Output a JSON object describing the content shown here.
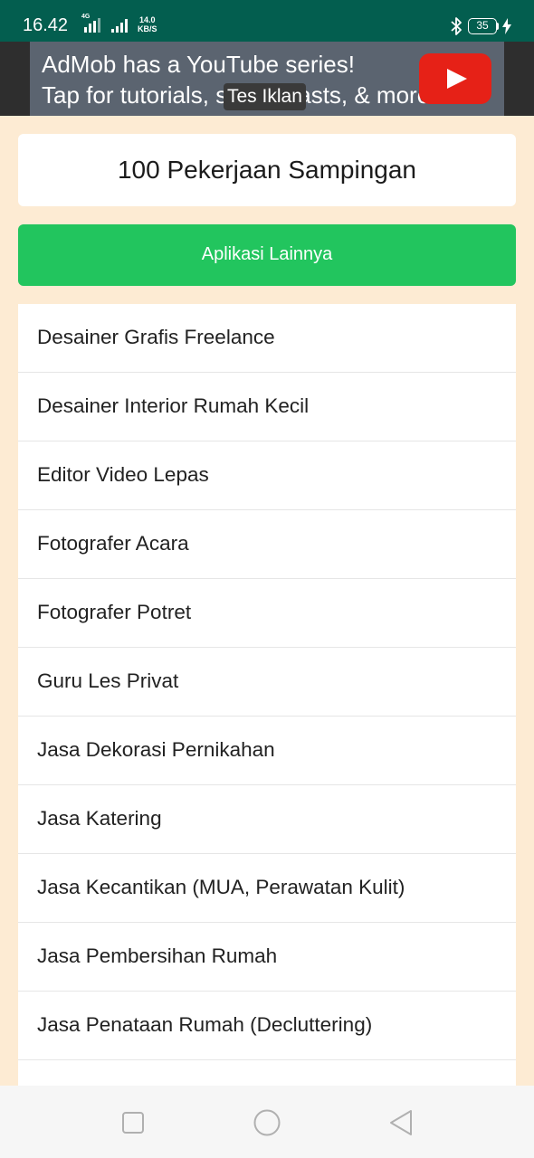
{
  "status_bar": {
    "time": "16.42",
    "network": "4G",
    "speed_value": "14.0",
    "speed_unit": "KB/S",
    "battery": "35",
    "icons": [
      "signal-icon",
      "signal-icon",
      "bluetooth-icon",
      "battery-icon",
      "charging-icon"
    ]
  },
  "ad": {
    "line1": "AdMob has a YouTube series!",
    "line2": "Tap for tutorials, screencasts, & more.",
    "badge": "Tes Iklan",
    "icon": "youtube-play-icon"
  },
  "page": {
    "title": "100 Pekerjaan Sampingan",
    "button_label": "Aplikasi Lainnya"
  },
  "list": [
    "Desainer Grafis Freelance",
    "Desainer Interior Rumah Kecil",
    "Editor Video Lepas",
    "Fotografer Acara",
    "Fotografer Potret",
    "Guru Les Privat",
    "Jasa Dekorasi Pernikahan",
    "Jasa Katering",
    "Jasa Kecantikan (MUA, Perawatan Kulit)",
    "Jasa Pembersihan Rumah",
    "Jasa Penataan Rumah (Decluttering)"
  ],
  "nav_bar": {
    "icons": [
      "recent-apps-icon",
      "home-icon",
      "back-icon"
    ]
  },
  "colors": {
    "status_bar": "#035e4f",
    "background": "#fdebd3",
    "button": "#22c55e",
    "ad_background": "#5b6470",
    "youtube_red": "#e62117"
  }
}
